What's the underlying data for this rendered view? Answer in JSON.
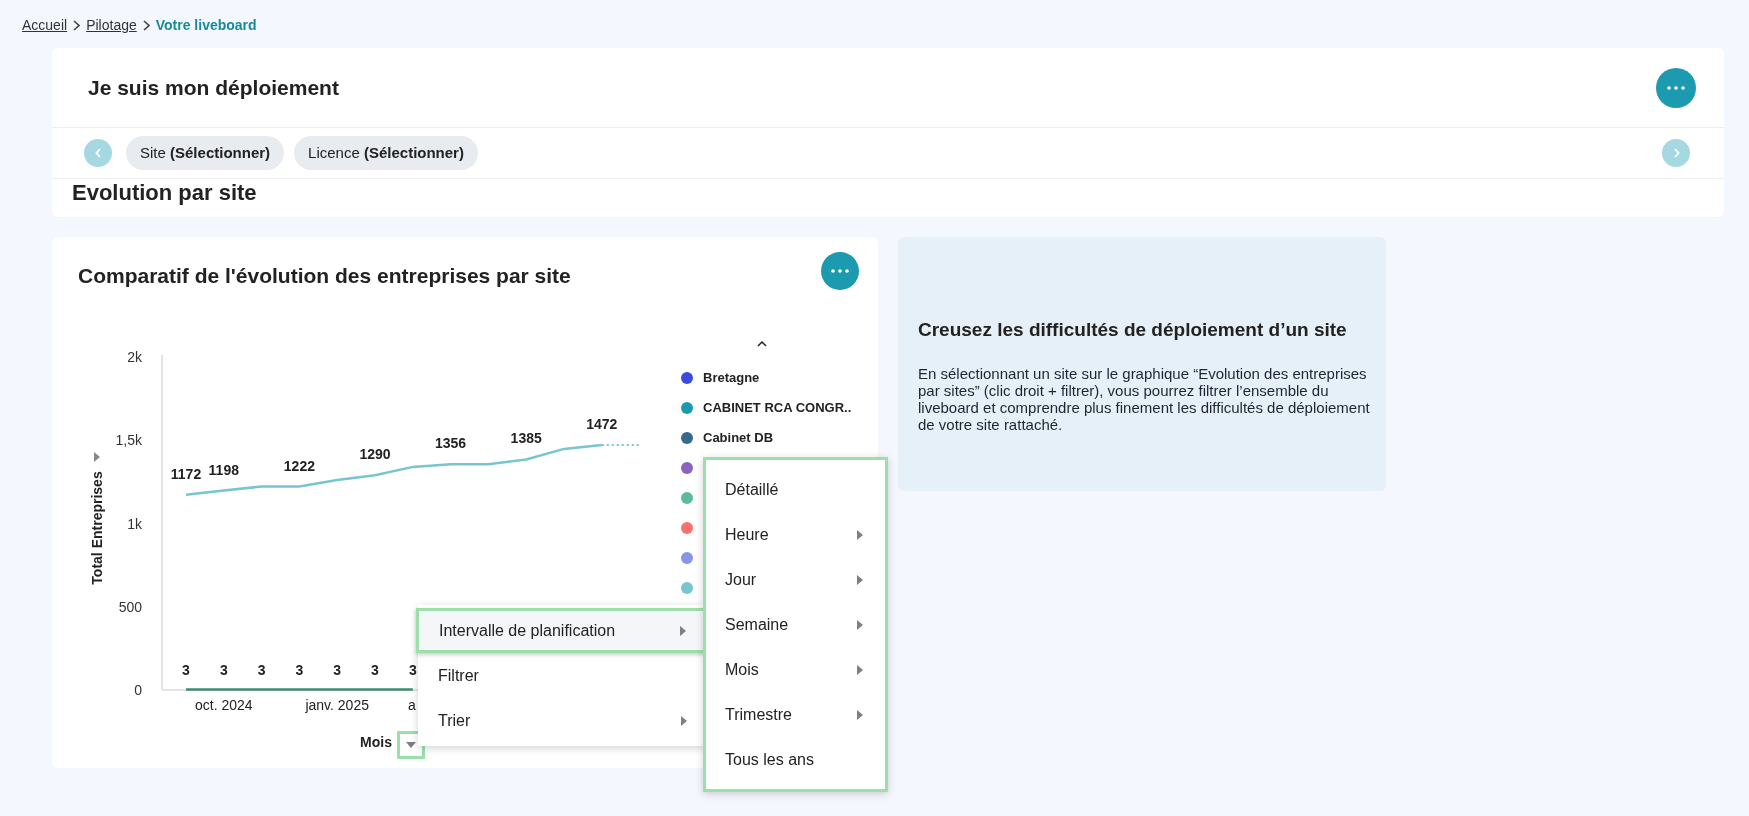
{
  "breadcrumb": [
    {
      "label": "Accueil",
      "current": false
    },
    {
      "label": "Pilotage",
      "current": false
    },
    {
      "label": "Votre liveboard",
      "current": true
    }
  ],
  "liveboard": {
    "title": "Je suis mon déploiement",
    "filters": [
      {
        "label": "Site",
        "value": "(Sélectionner)"
      },
      {
        "label": "Licence",
        "value": "(Sélectionner)"
      }
    ],
    "section_title": "Evolution par site"
  },
  "chart_card": {
    "title": "Comparatif de l'évolution des entreprises par site",
    "chart_data": {
      "type": "line",
      "ylabel": "Total Entreprises",
      "xlabel": "Mois",
      "ylim": [
        0,
        2000
      ],
      "yticks": [
        {
          "value": 0,
          "label": "0"
        },
        {
          "value": 500,
          "label": "500"
        },
        {
          "value": 1000,
          "label": "1k"
        },
        {
          "value": 1500,
          "label": "1,5k"
        },
        {
          "value": 2000,
          "label": "2k"
        }
      ],
      "categories": [
        null,
        "oct. 2024",
        null,
        null,
        "janv. 2025",
        null,
        "a",
        null,
        null,
        null,
        null,
        null
      ],
      "data_labels": true,
      "series": [
        {
          "color": "#76c5cf",
          "values": [
            1172,
            1198,
            1222,
            1222,
            1261,
            1290,
            1340,
            1356,
            1356,
            1385,
            1448,
            1472
          ],
          "value_labels": [
            "1172",
            "1198",
            null,
            "1222",
            null,
            "1290",
            null,
            "1356",
            null,
            "1385",
            null,
            "1472"
          ]
        },
        {
          "color": "#3d8a73",
          "values": [
            3,
            3,
            3,
            3,
            3,
            3,
            3,
            null,
            null,
            null,
            null,
            null
          ],
          "value_labels": [
            "3",
            "3",
            "3",
            "3",
            "3",
            "3",
            "3",
            null,
            null,
            null,
            null,
            null
          ]
        }
      ]
    },
    "legend": [
      {
        "name": "Bretagne",
        "color": "#3b4cdb"
      },
      {
        "name": "CABINET RCA CONGR..",
        "color": "#1b9aaa"
      },
      {
        "name": "Cabinet DB",
        "color": "#356a8f"
      },
      {
        "color": "#8a63c2"
      },
      {
        "color": "#5dbb9b"
      },
      {
        "color": "#f87171"
      },
      {
        "color": "#8b93e6"
      },
      {
        "color": "#76c5cf"
      }
    ],
    "context_menu": [
      {
        "label": "Intervalle de planification",
        "selected": true,
        "has_submenu": true
      },
      {
        "label": "Filtrer",
        "selected": false,
        "has_submenu": false
      },
      {
        "label": "Trier",
        "selected": false,
        "has_submenu": true
      }
    ],
    "submenu": [
      {
        "label": "Détaillé",
        "has_submenu": false
      },
      {
        "label": "Heure",
        "has_submenu": true
      },
      {
        "label": "Jour",
        "has_submenu": true
      },
      {
        "label": "Semaine",
        "has_submenu": true
      },
      {
        "label": "Mois",
        "has_submenu": true
      },
      {
        "label": "Trimestre",
        "has_submenu": true
      },
      {
        "label": "Tous les ans",
        "has_submenu": false
      }
    ]
  },
  "info_panel": {
    "title": "Creusez les difficultés de déploiement d’un site",
    "text": "En sélectionnant un site sur le graphique “Evolution des entreprises par sites” (clic droit + filtrer), vous pourrez filtrer l’ensemble du liveboard et comprendre plus finement les difficultés de déploiement de votre site rattaché."
  }
}
